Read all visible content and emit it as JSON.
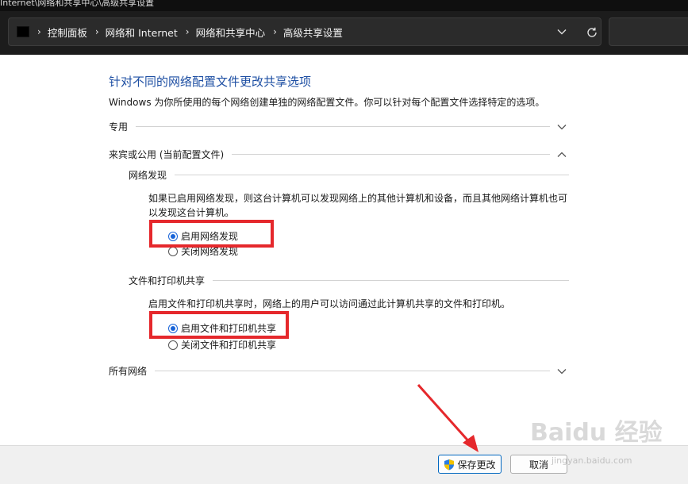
{
  "window": {
    "title": "Internet\\网络和共享中心\\高级共享设置"
  },
  "address_bar": {
    "breadcrumbs": [
      "控制面板",
      "网络和 Internet",
      "网络和共享中心",
      "高级共享设置"
    ]
  },
  "page": {
    "heading": "针对不同的网络配置文件更改共享选项",
    "description": "Windows 为你所使用的每个网络创建单独的网络配置文件。你可以针对每个配置文件选择特定的选项。"
  },
  "profiles": {
    "private": {
      "label": "专用",
      "expanded": false
    },
    "guest_public": {
      "label": "来宾或公用 (当前配置文件)",
      "expanded": true
    },
    "all_networks": {
      "label": "所有网络",
      "expanded": false
    }
  },
  "network_discovery": {
    "title": "网络发现",
    "description": "如果已启用网络发现，则这台计算机可以发现网络上的其他计算机和设备，而且其他网络计算机也可以发现这台计算机。",
    "options": [
      {
        "label": "启用网络发现",
        "selected": true
      },
      {
        "label": "关闭网络发现",
        "selected": false
      }
    ]
  },
  "file_printer_sharing": {
    "title": "文件和打印机共享",
    "description": "启用文件和打印机共享时，网络上的用户可以访问通过此计算机共享的文件和打印机。",
    "options": [
      {
        "label": "启用文件和打印机共享",
        "selected": true
      },
      {
        "label": "关闭文件和打印机共享",
        "selected": false
      }
    ]
  },
  "footer": {
    "save_label": "保存更改",
    "cancel_label": "取消"
  },
  "watermark": {
    "text": "Baidu 经验",
    "sub": "jingyan.baidu.com"
  },
  "colors": {
    "heading": "#1e4fa3",
    "highlight": "#e5282c",
    "radio_selected": "#1864d8",
    "dark_chrome": "#1c1c1c"
  }
}
